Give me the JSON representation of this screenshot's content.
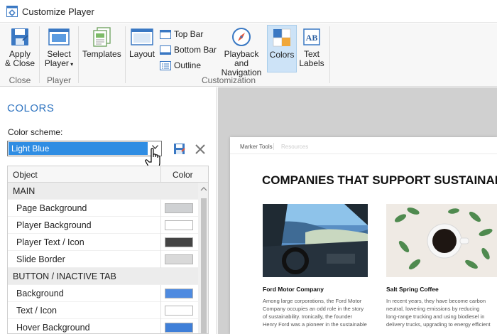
{
  "window": {
    "title": "Customize Player"
  },
  "ribbon": {
    "apply_close": "Apply\n& Close",
    "apply_label_1": "Apply",
    "apply_label_2": "& Close",
    "select_player_1": "Select",
    "select_player_2": "Player",
    "templates": "Templates",
    "layout": "Layout",
    "top_bar": "Top Bar",
    "bottom_bar": "Bottom Bar",
    "outline": "Outline",
    "playback_1": "Playback and",
    "playback_2": "Navigation",
    "colors": "Colors",
    "text_labels_1": "Text",
    "text_labels_2": "Labels",
    "groups": {
      "close": "Close",
      "player": "Player",
      "customization": "Customization"
    }
  },
  "panel": {
    "heading": "COLORS",
    "scheme_label": "Color scheme:",
    "scheme_value": "Light Blue",
    "table": {
      "col_object": "Object",
      "col_color": "Color",
      "rows": [
        {
          "type": "section",
          "label": "MAIN"
        },
        {
          "type": "item",
          "label": "Page Background",
          "color": "#cfd1d3"
        },
        {
          "type": "item",
          "label": "Player Background",
          "color": "#ffffff"
        },
        {
          "type": "item",
          "label": "Player Text / Icon",
          "color": "#444444"
        },
        {
          "type": "item",
          "label": "Slide Border",
          "color": "#d9d9d9"
        },
        {
          "type": "section",
          "label": "BUTTON / INACTIVE TAB"
        },
        {
          "type": "item",
          "label": "Background",
          "color": "#4f8be0"
        },
        {
          "type": "item",
          "label": "Text / Icon",
          "color": "#ffffff"
        },
        {
          "type": "item",
          "label": "Hover Background",
          "color": "#3f7fd8"
        }
      ]
    }
  },
  "preview": {
    "tab_active": "Marker Tools",
    "tab_inactive": "Resources",
    "title": "COMPANIES THAT SUPPORT SUSTAINAB",
    "articles": [
      {
        "title": "Ford Motor Company",
        "body": "Among large corporations, the Ford Motor Company occupies an odd role in the story of sustainability. Ironically, the founder Henry Ford was a pioneer in the sustainable"
      },
      {
        "title": "Salt Spring Coffee",
        "body": "In recent years, they have become carbon neutral, lowering emissions by reducing long-range trucking and using biodiesel in delivery trucks, upgrading to energy efficient"
      }
    ]
  },
  "colors": {
    "accent": "#2f74c0",
    "selection": "#2f8de3",
    "ribbon_selected": "#cde3f7"
  }
}
